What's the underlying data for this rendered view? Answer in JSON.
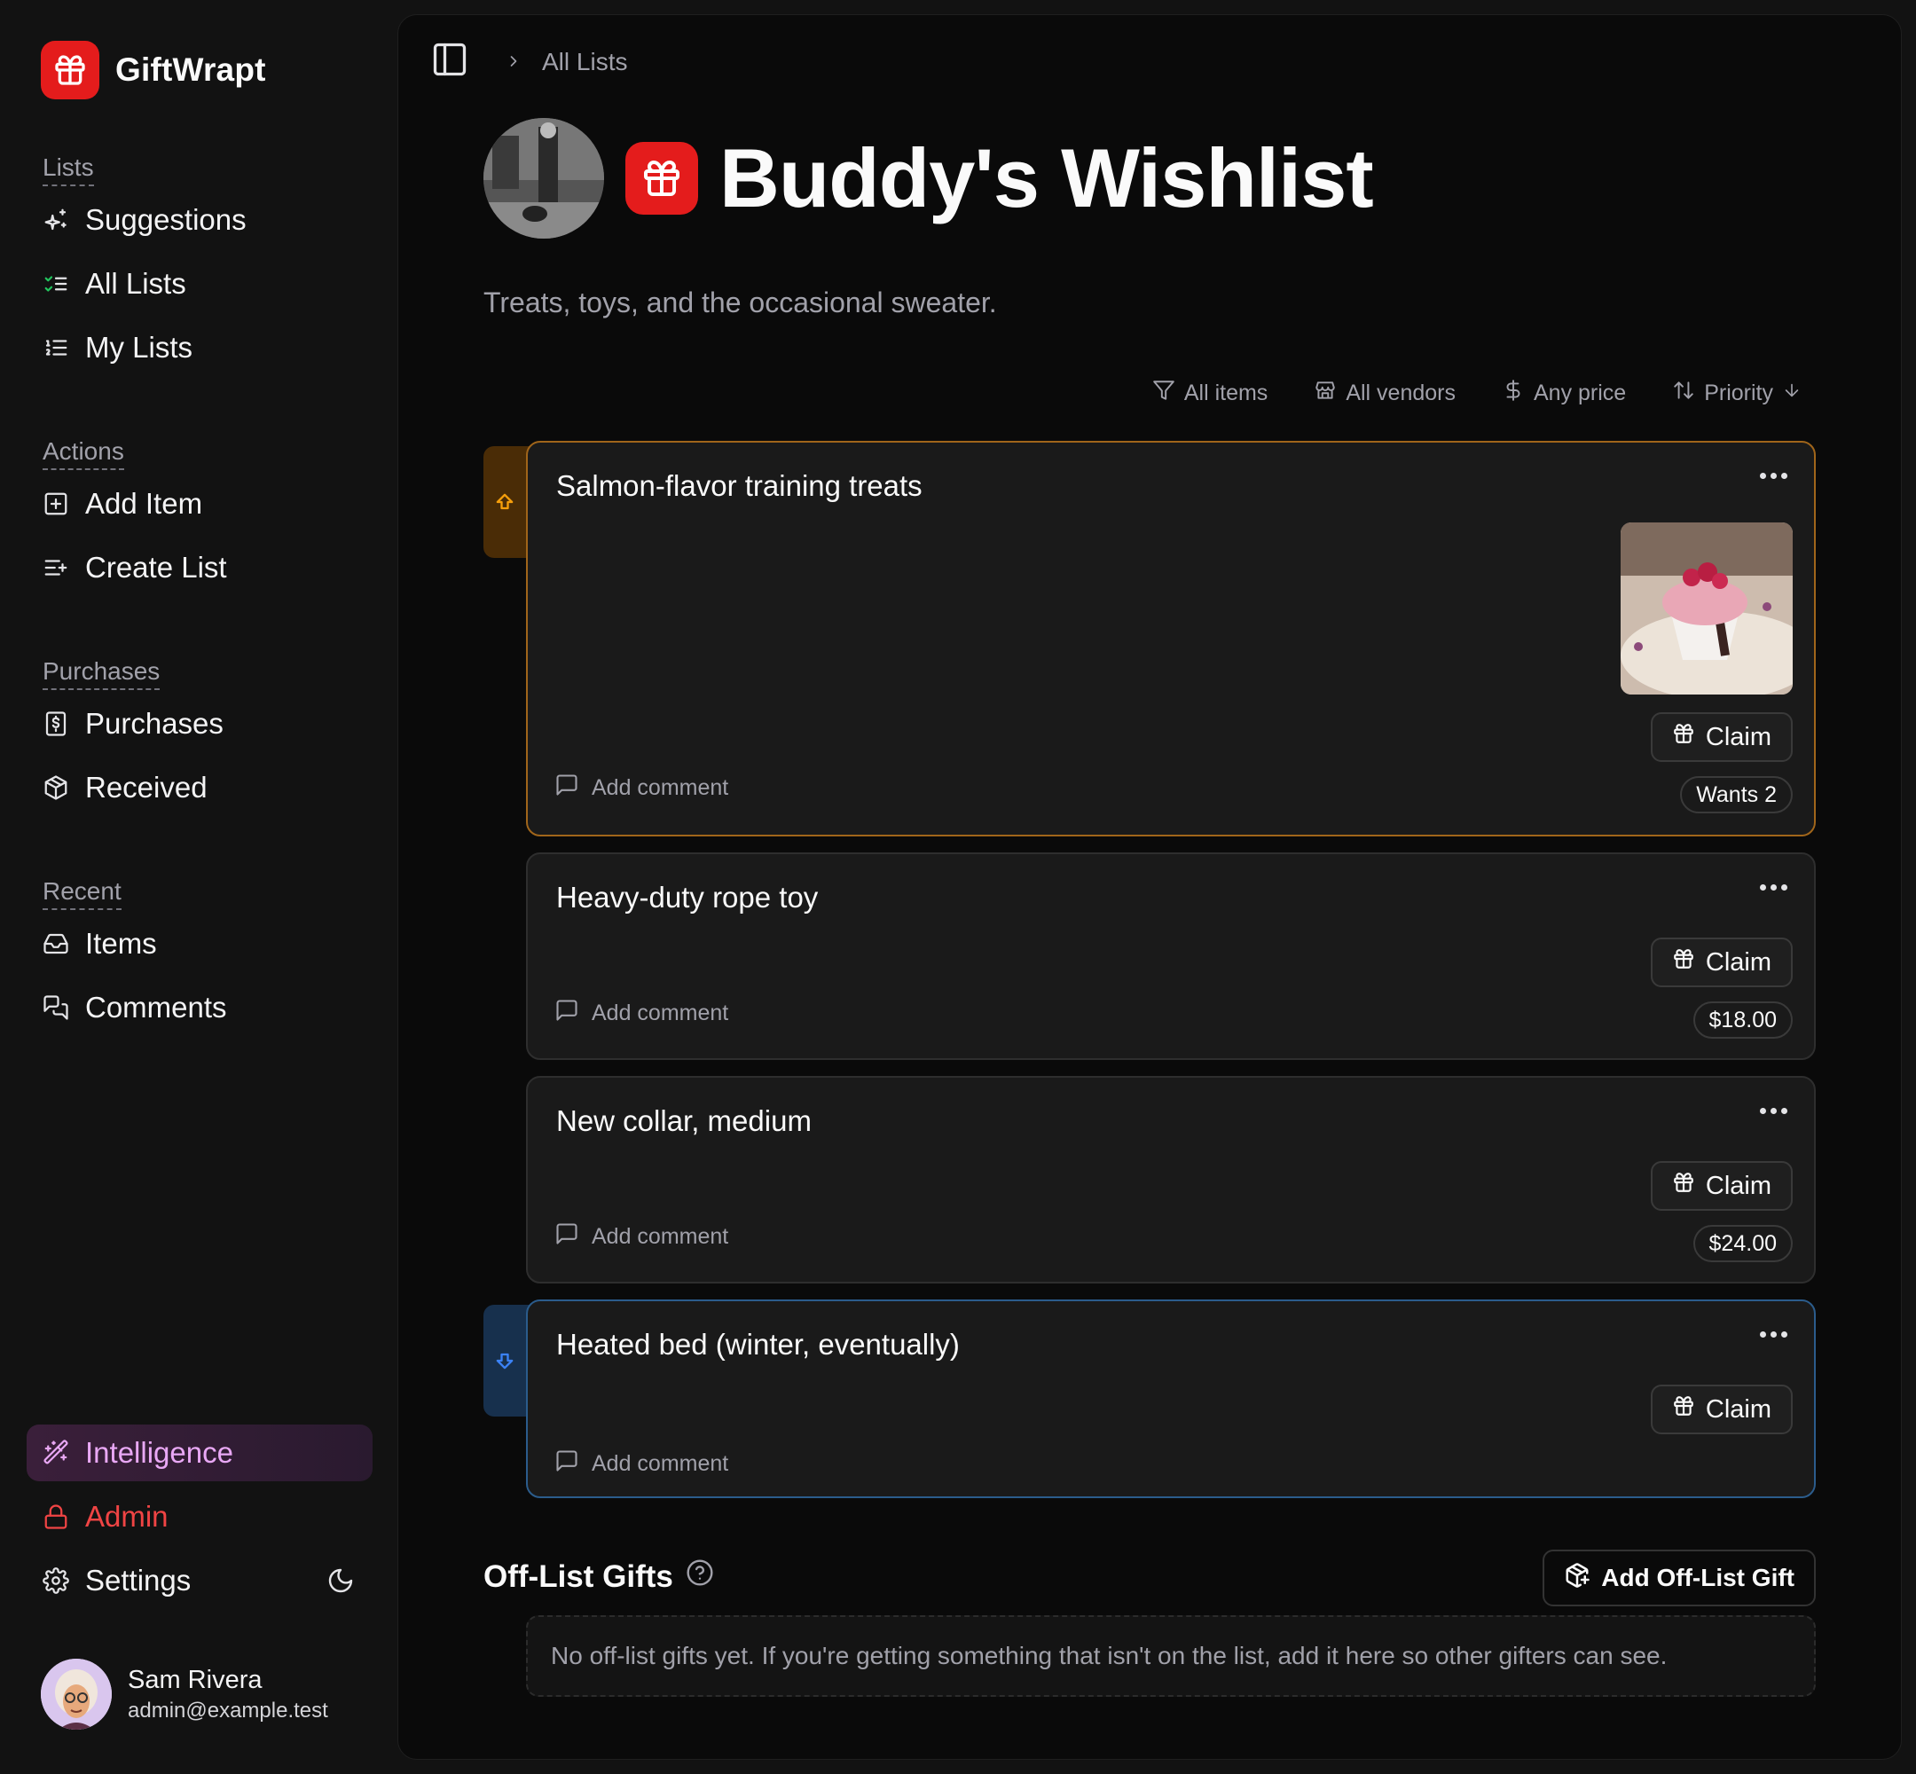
{
  "brand": {
    "name": "GiftWrapt"
  },
  "sidebar": {
    "sections": [
      {
        "heading": "Lists",
        "items": [
          {
            "label": "Suggestions",
            "icon": "sparkles-icon"
          },
          {
            "label": "All Lists",
            "icon": "list-checks-icon"
          },
          {
            "label": "My Lists",
            "icon": "list-ordered-icon"
          }
        ]
      },
      {
        "heading": "Actions",
        "items": [
          {
            "label": "Add Item",
            "icon": "plus-square-icon"
          },
          {
            "label": "Create List",
            "icon": "list-plus-icon"
          }
        ]
      },
      {
        "heading": "Purchases",
        "items": [
          {
            "label": "Purchases",
            "icon": "receipt-icon"
          },
          {
            "label": "Received",
            "icon": "package-open-icon"
          }
        ]
      },
      {
        "heading": "Recent",
        "items": [
          {
            "label": "Items",
            "icon": "inbox-icon"
          },
          {
            "label": "Comments",
            "icon": "messages-icon"
          }
        ]
      }
    ],
    "bottom": {
      "intelligence": "Intelligence",
      "admin": "Admin",
      "settings": "Settings"
    },
    "user": {
      "name": "Sam Rivera",
      "email": "admin@example.test"
    }
  },
  "breadcrumb": {
    "current": "All Lists"
  },
  "list": {
    "title": "Buddy's Wishlist",
    "description": "Treats, toys, and the occasional sweater."
  },
  "filters": {
    "items": "All items",
    "vendors": "All vendors",
    "price": "Any price",
    "sort": "Priority"
  },
  "items": [
    {
      "title": "Salmon-flavor training treats",
      "priority": "high",
      "claim": "Claim",
      "comment": "Add comment",
      "badge": "Wants 2"
    },
    {
      "title": "Heavy-duty rope toy",
      "priority": "normal",
      "claim": "Claim",
      "comment": "Add comment",
      "badge": "$18.00"
    },
    {
      "title": "New collar, medium",
      "priority": "normal",
      "claim": "Claim",
      "comment": "Add comment",
      "badge": "$24.00"
    },
    {
      "title": "Heated bed (winter, eventually)",
      "priority": "low",
      "claim": "Claim",
      "comment": "Add comment",
      "badge": ""
    }
  ],
  "offlist": {
    "title": "Off-List Gifts",
    "add_button": "Add Off-List Gift",
    "empty": "No off-list gifts yet. If you're getting something that isn't on the list, add it here so other gifters can see."
  },
  "colors": {
    "brand": "#e41c1c",
    "high_priority": "#a0651a",
    "low_priority": "#2b5c8c",
    "intelligence": "#e9a8f5",
    "admin": "#f04444"
  }
}
